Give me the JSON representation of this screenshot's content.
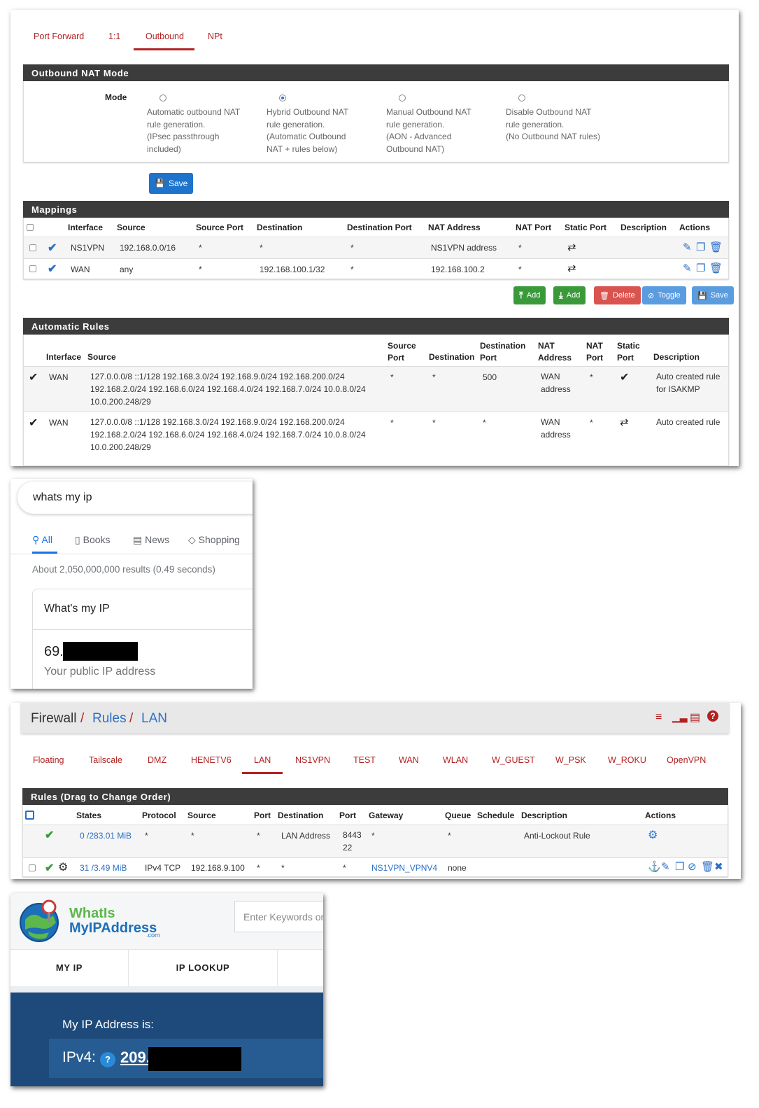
{
  "nat": {
    "tabs": [
      "Port Forward",
      "1:1",
      "Outbound",
      "NPt"
    ],
    "active_tab": "Outbound",
    "mode_panel_title": "Outbound NAT Mode",
    "mode_label": "Mode",
    "modes": [
      {
        "lines": [
          "Automatic outbound NAT",
          "rule generation.",
          "(IPsec passthrough",
          "included)"
        ],
        "selected": false
      },
      {
        "lines": [
          "Hybrid Outbound NAT",
          "rule generation.",
          "(Automatic Outbound",
          "NAT + rules below)"
        ],
        "selected": true
      },
      {
        "lines": [
          "Manual Outbound NAT",
          "rule generation.",
          "(AON - Advanced",
          "Outbound NAT)"
        ],
        "selected": false
      },
      {
        "lines": [
          "Disable Outbound NAT",
          "rule generation.",
          "(No Outbound NAT rules)"
        ],
        "selected": false
      }
    ],
    "save_label": "Save",
    "mappings_title": "Mappings",
    "mappings_headers": [
      "Interface",
      "Source",
      "Source Port",
      "Destination",
      "Destination Port",
      "NAT Address",
      "NAT Port",
      "Static Port",
      "Description",
      "Actions"
    ],
    "mappings_rows": [
      {
        "interface": "NS1VPN",
        "source": "192.168.0.0/16",
        "source_port": "*",
        "destination": "*",
        "destination_port": "*",
        "nat_address": "NS1VPN address",
        "nat_port": "*"
      },
      {
        "interface": "WAN",
        "source": "any",
        "source_port": "*",
        "destination": "192.168.100.1/32",
        "destination_port": "*",
        "nat_address": "192.168.100.2",
        "nat_port": "*"
      }
    ],
    "action_buttons": {
      "add_top": "Add",
      "add_bottom": "Add",
      "delete": "Delete",
      "toggle": "Toggle",
      "save": "Save"
    },
    "auto_title": "Automatic Rules",
    "auto_headers": {
      "interface": "Interface",
      "source": "Source",
      "source_port": [
        "Source",
        "Port"
      ],
      "destination": "Destination",
      "destination_port": [
        "Destination",
        "Port"
      ],
      "nat_address": [
        "NAT",
        "Address"
      ],
      "nat_port": [
        "NAT",
        "Port"
      ],
      "static_port": [
        "Static",
        "Port"
      ],
      "description": "Description"
    },
    "auto_rows": [
      {
        "interface": "WAN",
        "source": [
          "127.0.0.0/8 ::1/128 192.168.3.0/24 192.168.9.0/24 192.168.200.0/24",
          "192.168.2.0/24 192.168.6.0/24 192.168.4.0/24 192.168.7.0/24 10.0.8.0/24",
          "10.0.200.248/29"
        ],
        "source_port": "*",
        "destination": "*",
        "destination_port": "500",
        "nat_address": [
          "WAN",
          "address"
        ],
        "nat_port": "*",
        "static": "check",
        "description": [
          "Auto created rule",
          "for ISAKMP"
        ]
      },
      {
        "interface": "WAN",
        "source": [
          "127.0.0.0/8 ::1/128 192.168.3.0/24 192.168.9.0/24 192.168.200.0/24",
          "192.168.2.0/24 192.168.6.0/24 192.168.4.0/24 192.168.7.0/24 10.0.8.0/24",
          "10.0.200.248/29"
        ],
        "source_port": "*",
        "destination": "*",
        "destination_port": "*",
        "nat_address": [
          "WAN",
          "address"
        ],
        "nat_port": "*",
        "static": "shuffle",
        "description": [
          "Auto created rule"
        ]
      }
    ]
  },
  "google": {
    "query": "whats my ip",
    "tabs": [
      "All",
      "Books",
      "News",
      "Shopping"
    ],
    "result_stats": "About 2,050,000,000 results (0.49 seconds)",
    "card_title": "What's my IP",
    "ip_prefix": "69.",
    "ip_caption": "Your public IP address"
  },
  "firewall": {
    "breadcrumb": [
      "Firewall",
      "Rules",
      "LAN"
    ],
    "tabs": [
      "Floating",
      "Tailscale",
      "DMZ",
      "HENETV6",
      "LAN",
      "NS1VPN",
      "TEST",
      "WAN",
      "WLAN",
      "W_GUEST",
      "W_PSK",
      "W_ROKU",
      "OpenVPN"
    ],
    "active_tab": "LAN",
    "rules_title": "Rules (Drag to Change Order)",
    "headers": [
      "States",
      "Protocol",
      "Source",
      "Port",
      "Destination",
      "Port",
      "Gateway",
      "Queue",
      "Schedule",
      "Description",
      "Actions"
    ],
    "rows": [
      {
        "states": "0 /283.01 MiB",
        "protocol": "*",
        "source": "*",
        "port": "*",
        "destination": "LAN Address",
        "dest_port": [
          "8443",
          "22"
        ],
        "gateway": "*",
        "queue": "*",
        "schedule": "",
        "description": "Anti-Lockout Rule"
      },
      {
        "states": "31 /3.49 MiB",
        "protocol": "IPv4 TCP",
        "source": "192.168.9.100",
        "port": "*",
        "destination": "*",
        "dest_port": [
          "*"
        ],
        "gateway": "NS1VPN_VPNV4",
        "queue": "none",
        "schedule": "",
        "description": ""
      }
    ]
  },
  "wimia": {
    "logo_line1": "WhatIs",
    "logo_line2": "MyIPAddress",
    "logo_com": ".com",
    "search_placeholder": "Enter Keywords or",
    "nav": [
      "MY IP",
      "IP LOOKUP"
    ],
    "heading": "My IP Address is:",
    "ipv4_label": "IPv4:",
    "help_glyph": "?",
    "ip_prefix": "209."
  }
}
